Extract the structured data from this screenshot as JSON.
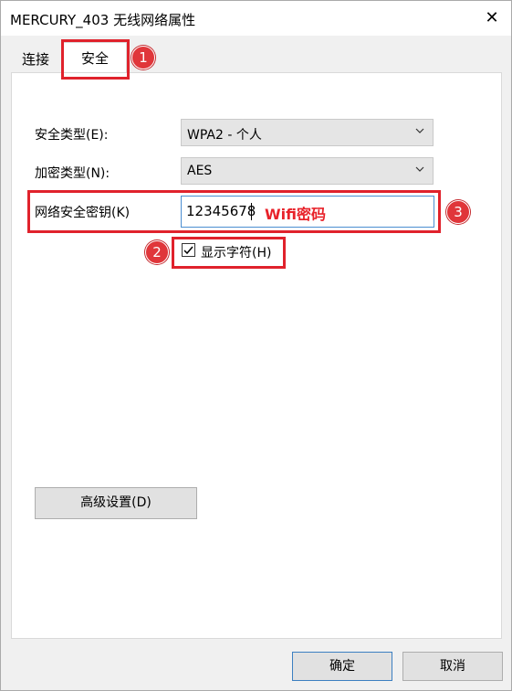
{
  "window": {
    "title": "MERCURY_403 无线网络属性",
    "close_glyph": "✕"
  },
  "tabs": [
    {
      "label": "连接",
      "active": false
    },
    {
      "label": "安全",
      "active": true
    }
  ],
  "form": {
    "security_type_label": "安全类型(E):",
    "security_type_value": "WPA2 - 个人",
    "encryption_type_label": "加密类型(N):",
    "encryption_type_value": "AES",
    "network_key_label": "网络安全密钥(K)",
    "network_key_value": "12345678",
    "show_chars_label": "显示字符(H)",
    "show_chars_checked": true,
    "advanced_button": "高级设置(D)"
  },
  "annotations": {
    "wifi_note": "Wifi密码",
    "badges": [
      "1",
      "2",
      "3"
    ],
    "highlight_color": "#e0222c"
  },
  "footer": {
    "ok_label": "确定",
    "cancel_label": "取消"
  },
  "icons": {
    "dropdown": "chevron-down-icon",
    "close": "close-icon",
    "check": "checkmark-icon"
  }
}
